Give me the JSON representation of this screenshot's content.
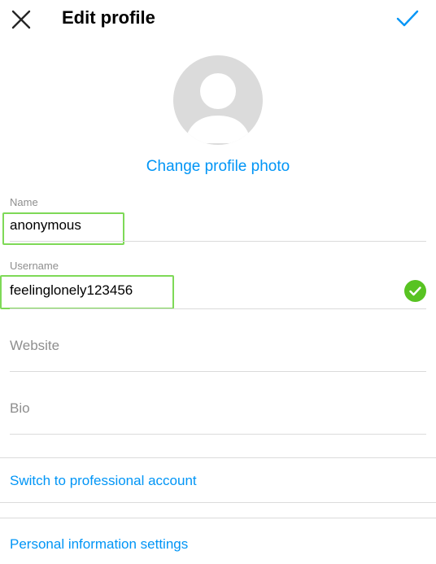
{
  "header": {
    "title": "Edit profile"
  },
  "profile_photo": {
    "change_label": "Change profile photo"
  },
  "fields": {
    "name": {
      "label": "Name",
      "value": "anonymous"
    },
    "username": {
      "label": "Username",
      "value": "feelinglonely123456"
    },
    "website": {
      "placeholder": "Website"
    },
    "bio": {
      "placeholder": "Bio"
    }
  },
  "links": {
    "professional": "Switch to professional account",
    "personal_info": "Personal information settings"
  },
  "colors": {
    "accent": "#0095f6",
    "valid_check": "#58c322",
    "highlight_box": "#7ed957"
  }
}
